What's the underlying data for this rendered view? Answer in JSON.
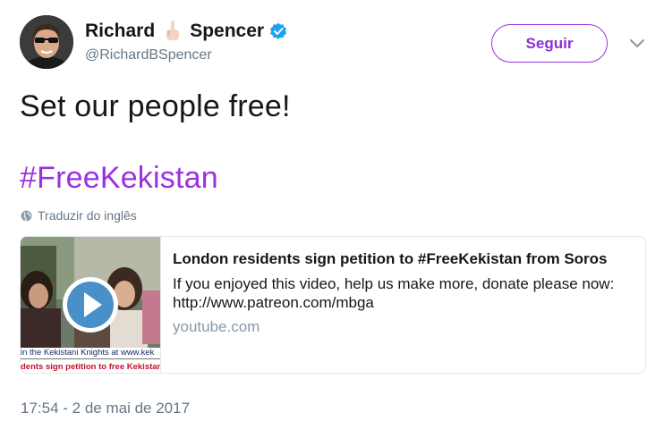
{
  "author": {
    "name_first": "Richard",
    "name_last": "Spencer",
    "handle": "@RichardBSpencer",
    "verified_color": "#1da1f2"
  },
  "follow_button": {
    "label": "Seguir",
    "color": "#9b30e0"
  },
  "tweet": {
    "text": "Set our people free!",
    "hashtag": "#FreeKekistan",
    "translate_label": "Traduzir do inglês",
    "timestamp": "17:54 - 2 de mai de 2017"
  },
  "card": {
    "title": "London residents sign petition to #FreeKekistan from Soros",
    "description": "If you enjoyed this video, help us make more, donate please now: http://www.patreon.com/mbga",
    "domain": "youtube.com",
    "thumb_ticker_top": "in the Kekistani Knights at www.kek",
    "thumb_ticker_bottom": "dents sign petition to free Kekistan"
  }
}
